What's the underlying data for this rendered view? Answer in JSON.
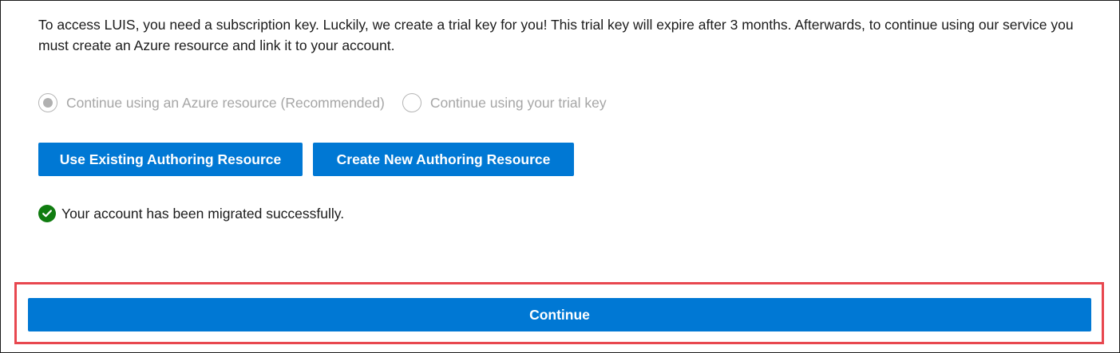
{
  "intro": {
    "text": "To access LUIS, you need a subscription key. Luckily, we create a trial key for you! This trial key will expire after 3 months. Afterwards, to continue using our service you must create an Azure resource and link it to your account."
  },
  "options": {
    "azure_resource": {
      "label": "Continue using an Azure resource (Recommended)",
      "selected": true,
      "disabled": true
    },
    "trial_key": {
      "label": "Continue using your trial key",
      "selected": false,
      "disabled": true
    }
  },
  "buttons": {
    "use_existing": "Use Existing Authoring Resource",
    "create_new": "Create New Authoring Resource",
    "continue": "Continue"
  },
  "status": {
    "message": "Your account has been migrated successfully.",
    "icon": "check-circle-icon",
    "color": "#107c10"
  },
  "colors": {
    "accent": "#0078d4",
    "highlight": "#e8474f"
  }
}
